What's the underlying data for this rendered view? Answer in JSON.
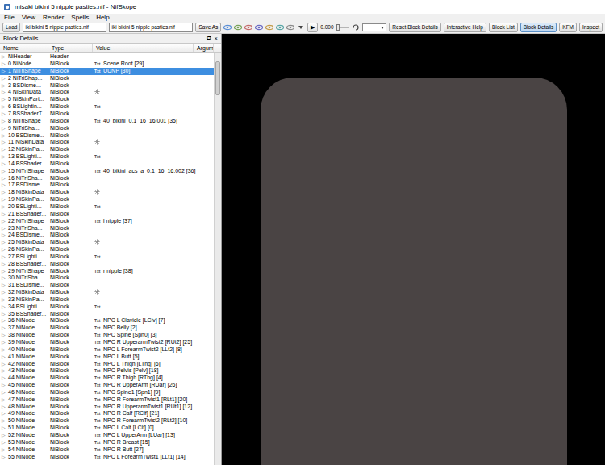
{
  "window": {
    "title": "misaki bikini 5 nipple pasties.nif - NifSkope"
  },
  "menu": [
    "File",
    "View",
    "Render",
    "Spells",
    "Help"
  ],
  "toolbar": {
    "load_button": "Load",
    "fields": [
      "iki bikini 5 nipple pasties.nif",
      "iki bikini 5 nipple pasties.nif"
    ],
    "save_button": "Save As",
    "play": "▶",
    "time": "0.000",
    "time_slider": {
      "level": 0
    },
    "view_buttons": [
      {
        "label": "Reset Block Details",
        "selected": false
      },
      {
        "label": "Interactive Help",
        "selected": false
      },
      {
        "label": "Block List",
        "selected": false
      },
      {
        "label": "Block Details",
        "selected": true
      },
      {
        "label": "KFM",
        "selected": false
      },
      {
        "label": "Inspect",
        "selected": false
      }
    ]
  },
  "panel": {
    "title": "Block Details",
    "float": "⧉",
    "close": "×"
  },
  "table": {
    "columns": [
      "Name",
      "Type",
      "Value",
      "Argum"
    ],
    "expander": "▷",
    "txt_label": "Txt",
    "rows": [
      {
        "name": "NiHeader",
        "type": "Header",
        "value": "",
        "kind": "none",
        "selected": false
      },
      {
        "name": "0 NiNode",
        "type": "NiBlock",
        "value": "Scene Root [29]",
        "kind": "txt",
        "selected": false
      },
      {
        "name": "1 NiTriShape",
        "type": "NiBlock",
        "value": "UUNP [30]",
        "kind": "txt",
        "selected": true
      },
      {
        "name": "2 NiTriShap...",
        "type": "NiBlock",
        "value": "",
        "kind": "none",
        "selected": false
      },
      {
        "name": "3 BSDisme...",
        "type": "NiBlock",
        "value": "",
        "kind": "none",
        "selected": false
      },
      {
        "name": "4 NiSkinData",
        "type": "NiBlock",
        "value": "",
        "kind": "skin",
        "selected": false
      },
      {
        "name": "5 NiSkinPart...",
        "type": "NiBlock",
        "value": "",
        "kind": "none",
        "selected": false
      },
      {
        "name": "6 BSLightin...",
        "type": "NiBlock",
        "value": "",
        "kind": "txt",
        "selected": false
      },
      {
        "name": "7 BSShaderT...",
        "type": "NiBlock",
        "value": "",
        "kind": "none",
        "selected": false
      },
      {
        "name": "8 NiTriShape",
        "type": "NiBlock",
        "value": "40_bikini_0.1_16_16.001 [35]",
        "kind": "txt",
        "selected": false
      },
      {
        "name": "9 NiTriSha...",
        "type": "NiBlock",
        "value": "",
        "kind": "none",
        "selected": false
      },
      {
        "name": "10 BSDisme...",
        "type": "NiBlock",
        "value": "",
        "kind": "none",
        "selected": false
      },
      {
        "name": "11 NiSkinData",
        "type": "NiBlock",
        "value": "",
        "kind": "skin",
        "selected": false
      },
      {
        "name": "12 NiSkinPa...",
        "type": "NiBlock",
        "value": "",
        "kind": "none",
        "selected": false
      },
      {
        "name": "13 BSLighti...",
        "type": "NiBlock",
        "value": "",
        "kind": "txt",
        "selected": false
      },
      {
        "name": "14 BSShader...",
        "type": "NiBlock",
        "value": "",
        "kind": "none",
        "selected": false
      },
      {
        "name": "15 NiTriShape",
        "type": "NiBlock",
        "value": "40_bikini_acs_a_0.1_16_16.002 [36]",
        "kind": "txt",
        "selected": false
      },
      {
        "name": "16 NiTriSha...",
        "type": "NiBlock",
        "value": "",
        "kind": "none",
        "selected": false
      },
      {
        "name": "17 BSDisme...",
        "type": "NiBlock",
        "value": "",
        "kind": "none",
        "selected": false
      },
      {
        "name": "18 NiSkinData",
        "type": "NiBlock",
        "value": "",
        "kind": "skin",
        "selected": false
      },
      {
        "name": "19 NiSkinPa...",
        "type": "NiBlock",
        "value": "",
        "kind": "none",
        "selected": false
      },
      {
        "name": "20 BSLighti...",
        "type": "NiBlock",
        "value": "",
        "kind": "txt",
        "selected": false
      },
      {
        "name": "21 BSShader...",
        "type": "NiBlock",
        "value": "",
        "kind": "none",
        "selected": false
      },
      {
        "name": "22 NiTriShape",
        "type": "NiBlock",
        "value": "l nipple [37]",
        "kind": "txt",
        "selected": false
      },
      {
        "name": "23 NiTriSha...",
        "type": "NiBlock",
        "value": "",
        "kind": "none",
        "selected": false
      },
      {
        "name": "24 BSDisme...",
        "type": "NiBlock",
        "value": "",
        "kind": "none",
        "selected": false
      },
      {
        "name": "25 NiSkinData",
        "type": "NiBlock",
        "value": "",
        "kind": "skin",
        "selected": false
      },
      {
        "name": "26 NiSkinPa...",
        "type": "NiBlock",
        "value": "",
        "kind": "none",
        "selected": false
      },
      {
        "name": "27 BSLighti...",
        "type": "NiBlock",
        "value": "",
        "kind": "txt",
        "selected": false
      },
      {
        "name": "28 BSShader...",
        "type": "NiBlock",
        "value": "",
        "kind": "none",
        "selected": false
      },
      {
        "name": "29 NiTriShape",
        "type": "NiBlock",
        "value": "r nipple [38]",
        "kind": "txt",
        "selected": false
      },
      {
        "name": "30 NiTriSha...",
        "type": "NiBlock",
        "value": "",
        "kind": "none",
        "selected": false
      },
      {
        "name": "31 BSDisme...",
        "type": "NiBlock",
        "value": "",
        "kind": "none",
        "selected": false
      },
      {
        "name": "32 NiSkinData",
        "type": "NiBlock",
        "value": "",
        "kind": "skin",
        "selected": false
      },
      {
        "name": "33 NiSkinPa...",
        "type": "NiBlock",
        "value": "",
        "kind": "none",
        "selected": false
      },
      {
        "name": "34 BSLighti...",
        "type": "NiBlock",
        "value": "",
        "kind": "txt",
        "selected": false
      },
      {
        "name": "35 BSShader...",
        "type": "NiBlock",
        "value": "",
        "kind": "none",
        "selected": false
      },
      {
        "name": "36 NiNode",
        "type": "NiBlock",
        "value": "NPC L Clavicle [LClv] [7]",
        "kind": "txt",
        "selected": false
      },
      {
        "name": "37 NiNode",
        "type": "NiBlock",
        "value": "NPC Belly [2]",
        "kind": "txt",
        "selected": false
      },
      {
        "name": "38 NiNode",
        "type": "NiBlock",
        "value": "NPC Spine [Spn0] [3]",
        "kind": "txt",
        "selected": false
      },
      {
        "name": "39 NiNode",
        "type": "NiBlock",
        "value": "NPC R UpperarmTwist2 [RUt2] [25]",
        "kind": "txt",
        "selected": false
      },
      {
        "name": "40 NiNode",
        "type": "NiBlock",
        "value": "NPC L ForearmTwist2 [LLt2] [8]",
        "kind": "txt",
        "selected": false
      },
      {
        "name": "41 NiNode",
        "type": "NiBlock",
        "value": "NPC L Butt [5]",
        "kind": "txt",
        "selected": false
      },
      {
        "name": "42 NiNode",
        "type": "NiBlock",
        "value": "NPC L Thigh [LThg] [6]",
        "kind": "txt",
        "selected": false
      },
      {
        "name": "43 NiNode",
        "type": "NiBlock",
        "value": "NPC Pelvis [Pelv] [18]",
        "kind": "txt",
        "selected": false
      },
      {
        "name": "44 NiNode",
        "type": "NiBlock",
        "value": "NPC R Thigh [RThg] [4]",
        "kind": "txt",
        "selected": false
      },
      {
        "name": "45 NiNode",
        "type": "NiBlock",
        "value": "NPC R UpperArm [RUar] [26]",
        "kind": "txt",
        "selected": false
      },
      {
        "name": "46 NiNode",
        "type": "NiBlock",
        "value": "NPC Spine1 [Spn1] [9]",
        "kind": "txt",
        "selected": false
      },
      {
        "name": "47 NiNode",
        "type": "NiBlock",
        "value": "NPC R ForearmTwist1 [RLt1] [20]",
        "kind": "txt",
        "selected": false
      },
      {
        "name": "48 NiNode",
        "type": "NiBlock",
        "value": "NPC R UpperarmTwist1 [RUt1] [12]",
        "kind": "txt",
        "selected": false
      },
      {
        "name": "49 NiNode",
        "type": "NiBlock",
        "value": "NPC R Calf [RClf] [21]",
        "kind": "txt",
        "selected": false
      },
      {
        "name": "50 NiNode",
        "type": "NiBlock",
        "value": "NPC R ForearmTwist2 [RLt2] [10]",
        "kind": "txt",
        "selected": false
      },
      {
        "name": "51 NiNode",
        "type": "NiBlock",
        "value": "NPC L Calf [LClf] [0]",
        "kind": "txt",
        "selected": false
      },
      {
        "name": "52 NiNode",
        "type": "NiBlock",
        "value": "NPC L UpperArm [LUar] [13]",
        "kind": "txt",
        "selected": false
      },
      {
        "name": "53 NiNode",
        "type": "NiBlock",
        "value": "NPC R Breast [15]",
        "kind": "txt",
        "selected": false
      },
      {
        "name": "54 NiNode",
        "type": "NiBlock",
        "value": "NPC R Butt [27]",
        "kind": "txt",
        "selected": false
      },
      {
        "name": "55 NiNode",
        "type": "NiBlock",
        "value": "NPC L ForearmTwist1 [LLt1] [14]",
        "kind": "txt",
        "selected": false
      }
    ]
  }
}
